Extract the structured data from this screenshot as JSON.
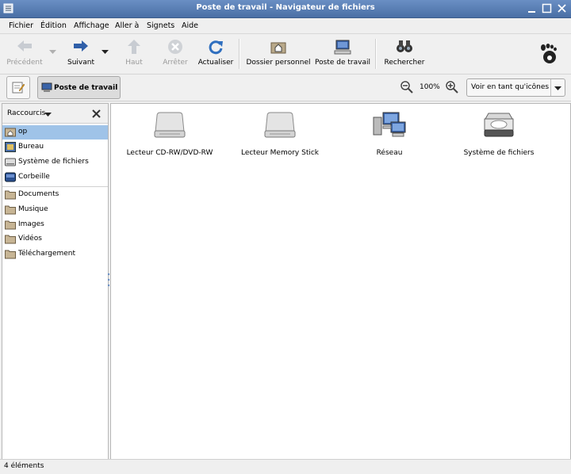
{
  "window": {
    "title": "Poste de travail - Navigateur de fichiers"
  },
  "menu": [
    "Fichier",
    "Édition",
    "Affichage",
    "Aller à",
    "Signets",
    "Aide"
  ],
  "toolbar": {
    "back": "Précédent",
    "forward": "Suivant",
    "up": "Haut",
    "stop": "Arrêter",
    "reload": "Actualiser",
    "home": "Dossier personnel",
    "computer": "Poste de travail",
    "search": "Rechercher"
  },
  "location": {
    "current": "Poste de travail",
    "zoom": "100%",
    "view_mode": "Voir en tant qu'icônes"
  },
  "sidebar": {
    "header": "Raccourcis",
    "items": [
      {
        "label": "op",
        "icon": "home-folder-icon",
        "selected": true
      },
      {
        "label": "Bureau",
        "icon": "desktop-icon"
      },
      {
        "label": "Système de fichiers",
        "icon": "filesystem-icon"
      },
      {
        "label": "Corbeille",
        "icon": "trash-icon"
      }
    ],
    "bookmarks": [
      {
        "label": "Documents",
        "icon": "folder-icon"
      },
      {
        "label": "Musique",
        "icon": "folder-icon"
      },
      {
        "label": "Images",
        "icon": "folder-icon"
      },
      {
        "label": "Vidéos",
        "icon": "folder-icon"
      },
      {
        "label": "Téléchargement",
        "icon": "folder-icon"
      }
    ]
  },
  "devices": [
    {
      "label": "Lecteur CD-RW/DVD-RW",
      "icon": "optical-drive-icon"
    },
    {
      "label": "Lecteur Memory Stick",
      "icon": "memory-stick-drive-icon"
    },
    {
      "label": "Réseau",
      "icon": "network-icon"
    },
    {
      "label": "Système de fichiers",
      "icon": "harddisk-icon"
    }
  ],
  "status": {
    "text": "4 éléments"
  },
  "colors": {
    "titlebar": "#5a7fb5",
    "selection": "#9fc3e8"
  }
}
